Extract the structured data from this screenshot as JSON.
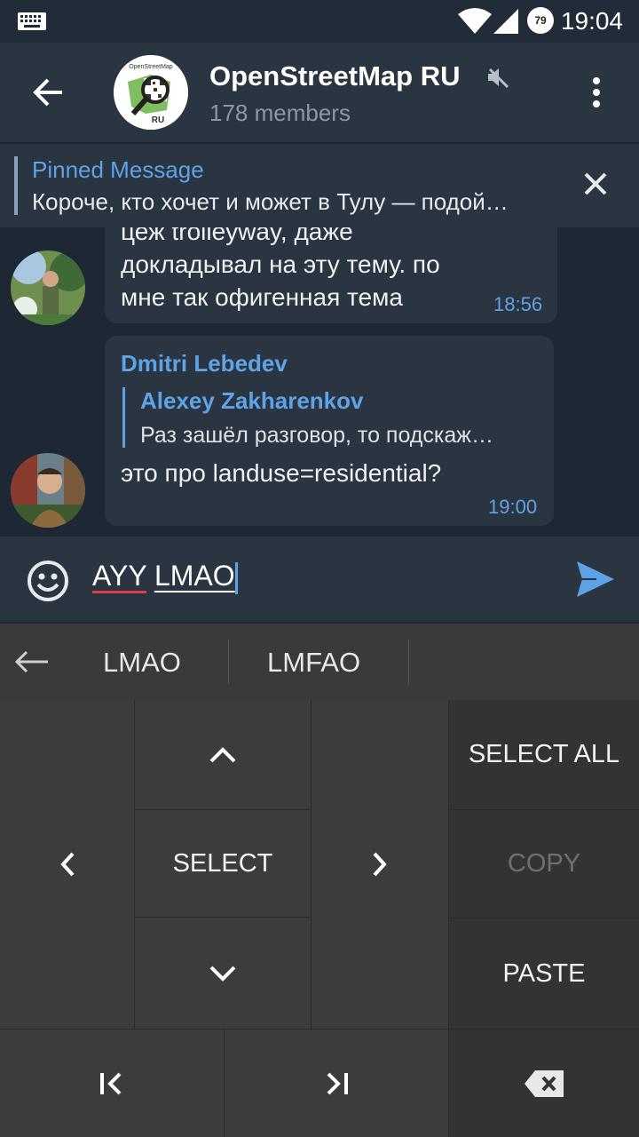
{
  "status_bar": {
    "time": "19:04",
    "battery": "79",
    "icons": [
      "keyboard-icon",
      "wifi-icon",
      "cell-signal-icon",
      "battery-icon"
    ]
  },
  "header": {
    "title": "OpenStreetMap RU",
    "subtitle": "178 members",
    "avatar_text_top": "OpenStreetMap",
    "avatar_text_bottom": "RU"
  },
  "pinned": {
    "label": "Pinned Message",
    "text": "Короче, кто хочет и может в Тулу — подой…"
  },
  "messages": [
    {
      "lines": [
        "цеж trolleyway, даже",
        "докладывал на эту тему. по",
        "мне так офигенная тема"
      ],
      "time": "18:56"
    },
    {
      "sender": "Dmitri Lebedev",
      "quote_name": "Alexey Zakharenkov",
      "quote_text": "Раз зашёл разговор, то подскаж…",
      "text": "это про landuse=residential?",
      "time": "19:00"
    }
  ],
  "input": {
    "word1": "AYY",
    "word2": "LMAO"
  },
  "suggestions": [
    "LMAO",
    "LMFAO"
  ],
  "keyboard": {
    "select_all": "SELECT ALL",
    "select": "SELECT",
    "copy": "COPY",
    "paste": "PASTE"
  },
  "colors": {
    "accent": "#5ea3e6",
    "header_bg": "#2b3441",
    "chat_bg": "#1e2835",
    "bubble_bg": "#2b3441",
    "keyboard_bg": "#3c3c3c"
  }
}
